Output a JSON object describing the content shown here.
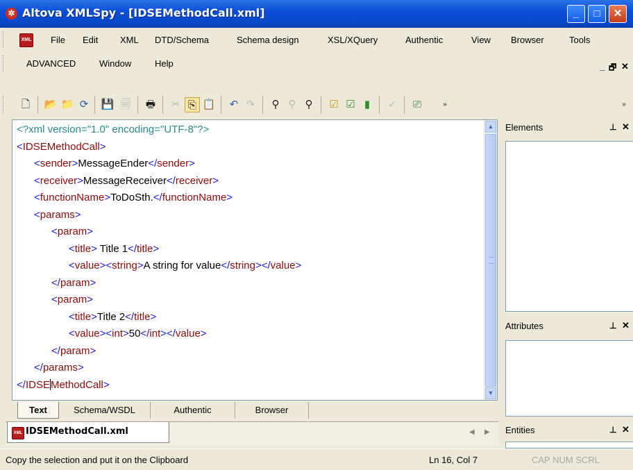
{
  "window": {
    "title": "Altova XMLSpy - [IDSEMethodCall.xml]",
    "app_icon": "xmlspy-logo-icon",
    "controls": {
      "minimize": "_",
      "maximize": "□",
      "close": "✕"
    }
  },
  "menu": {
    "doc_icon": "xml-document-icon",
    "row1": [
      "File",
      "Edit",
      "XML",
      "DTD/Schema",
      "Schema design",
      "XSL/XQuery",
      "Authentic",
      "View",
      "Browser",
      "Tools"
    ],
    "row2": [
      "ADVANCED",
      "Window",
      "Help"
    ],
    "mdi_controls": {
      "minimize": "_",
      "restore": "🗗",
      "close": "✕"
    }
  },
  "toolbar": {
    "icons": [
      "new-icon",
      "open-icon",
      "open-url-icon",
      "reload-icon",
      "save-icon",
      "save-all-icon",
      "print-icon",
      "cut-icon",
      "copy-icon",
      "paste-icon",
      "undo-icon",
      "redo-icon",
      "find-icon",
      "find-in-files-icon",
      "replace-icon",
      "check-wellformed-icon",
      "validate-icon",
      "toggle-icon",
      "spellcheck-icon",
      "xsl-transform-icon"
    ]
  },
  "editor": {
    "lines": [
      {
        "indent": 0,
        "parts": [
          [
            "pi",
            "<?xml version=\"1.0\" encoding=\"UTF-8\"?>"
          ]
        ]
      },
      {
        "indent": 0,
        "parts": [
          [
            "tag",
            "<"
          ],
          [
            "tn",
            "IDSEMethodCall"
          ],
          [
            "tag",
            ">"
          ]
        ]
      },
      {
        "indent": 1,
        "parts": [
          [
            "tag",
            "<"
          ],
          [
            "tn",
            "sender"
          ],
          [
            "tag",
            ">"
          ],
          [
            "txt",
            "MessageEnder"
          ],
          [
            "tag",
            "</"
          ],
          [
            "tn",
            "sender"
          ],
          [
            "tag",
            ">"
          ]
        ]
      },
      {
        "indent": 1,
        "parts": [
          [
            "tag",
            "<"
          ],
          [
            "tn",
            "receiver"
          ],
          [
            "tag",
            ">"
          ],
          [
            "txt",
            "MessageReceiver"
          ],
          [
            "tag",
            "</"
          ],
          [
            "tn",
            "receiver"
          ],
          [
            "tag",
            ">"
          ]
        ]
      },
      {
        "indent": 1,
        "parts": [
          [
            "tag",
            "<"
          ],
          [
            "tn",
            "functionName"
          ],
          [
            "tag",
            ">"
          ],
          [
            "txt",
            "ToDoSth."
          ],
          [
            "tag",
            "</"
          ],
          [
            "tn",
            "functionName"
          ],
          [
            "tag",
            ">"
          ]
        ]
      },
      {
        "indent": 1,
        "parts": [
          [
            "tag",
            "<"
          ],
          [
            "tn",
            "params"
          ],
          [
            "tag",
            ">"
          ]
        ]
      },
      {
        "indent": 2,
        "parts": [
          [
            "tag",
            "<"
          ],
          [
            "tn",
            "param"
          ],
          [
            "tag",
            ">"
          ]
        ]
      },
      {
        "indent": 3,
        "parts": [
          [
            "tag",
            "<"
          ],
          [
            "tn",
            "title"
          ],
          [
            "tag",
            ">"
          ],
          [
            "txt",
            " Title 1"
          ],
          [
            "tag",
            "</"
          ],
          [
            "tn",
            "title"
          ],
          [
            "tag",
            ">"
          ]
        ]
      },
      {
        "indent": 3,
        "parts": [
          [
            "tag",
            "<"
          ],
          [
            "tn",
            "value"
          ],
          [
            "tag",
            "><"
          ],
          [
            "tn",
            "string"
          ],
          [
            "tag",
            ">"
          ],
          [
            "txt",
            "A string for value"
          ],
          [
            "tag",
            "</"
          ],
          [
            "tn",
            "string"
          ],
          [
            "tag",
            "></"
          ],
          [
            "tn",
            "value"
          ],
          [
            "tag",
            ">"
          ]
        ]
      },
      {
        "indent": 2,
        "parts": [
          [
            "tag",
            "</"
          ],
          [
            "tn",
            "param"
          ],
          [
            "tag",
            ">"
          ]
        ]
      },
      {
        "indent": 2,
        "parts": [
          [
            "tag",
            "<"
          ],
          [
            "tn",
            "param"
          ],
          [
            "tag",
            ">"
          ]
        ]
      },
      {
        "indent": 3,
        "parts": [
          [
            "tag",
            "<"
          ],
          [
            "tn",
            "title"
          ],
          [
            "tag",
            ">"
          ],
          [
            "txt",
            "Title 2"
          ],
          [
            "tag",
            "</"
          ],
          [
            "tn",
            "title"
          ],
          [
            "tag",
            ">"
          ]
        ]
      },
      {
        "indent": 3,
        "parts": [
          [
            "tag",
            "<"
          ],
          [
            "tn",
            "value"
          ],
          [
            "tag",
            "><"
          ],
          [
            "tn",
            "int"
          ],
          [
            "tag",
            ">"
          ],
          [
            "txt",
            "50"
          ],
          [
            "tag",
            "</"
          ],
          [
            "tn",
            "int"
          ],
          [
            "tag",
            "></"
          ],
          [
            "tn",
            "value"
          ],
          [
            "tag",
            ">"
          ]
        ]
      },
      {
        "indent": 2,
        "parts": [
          [
            "tag",
            "</"
          ],
          [
            "tn",
            "param"
          ],
          [
            "tag",
            ">"
          ]
        ]
      },
      {
        "indent": 1,
        "parts": [
          [
            "tag",
            "</"
          ],
          [
            "tn",
            "params"
          ],
          [
            "tag",
            ">"
          ]
        ]
      },
      {
        "indent": 0,
        "parts": [
          [
            "tag",
            "</"
          ],
          [
            "tn",
            "IDSE"
          ],
          [
            "caret",
            ""
          ],
          [
            "tn",
            "MethodCall"
          ],
          [
            "tag",
            ">"
          ]
        ]
      }
    ]
  },
  "view_tabs": [
    "Text",
    "Schema/WSDL",
    "Authentic",
    "Browser"
  ],
  "doc_tab": {
    "label": "IDSEMethodCall.xml",
    "icon": "xml-document-icon"
  },
  "panels": [
    {
      "title": "Elements"
    },
    {
      "title": "Attributes"
    },
    {
      "title": "Entities"
    }
  ],
  "status": {
    "message": "Copy the selection and put it on the Clipboard",
    "position": "Ln 16, Col 7",
    "keys": "CAP  NUM  SCRL"
  },
  "colors": {
    "tag": "#1a1ad0",
    "tag_name": "#8b0a0a",
    "processing_instruction": "#2a8a8a",
    "titlebar": "#0a4fd6"
  }
}
